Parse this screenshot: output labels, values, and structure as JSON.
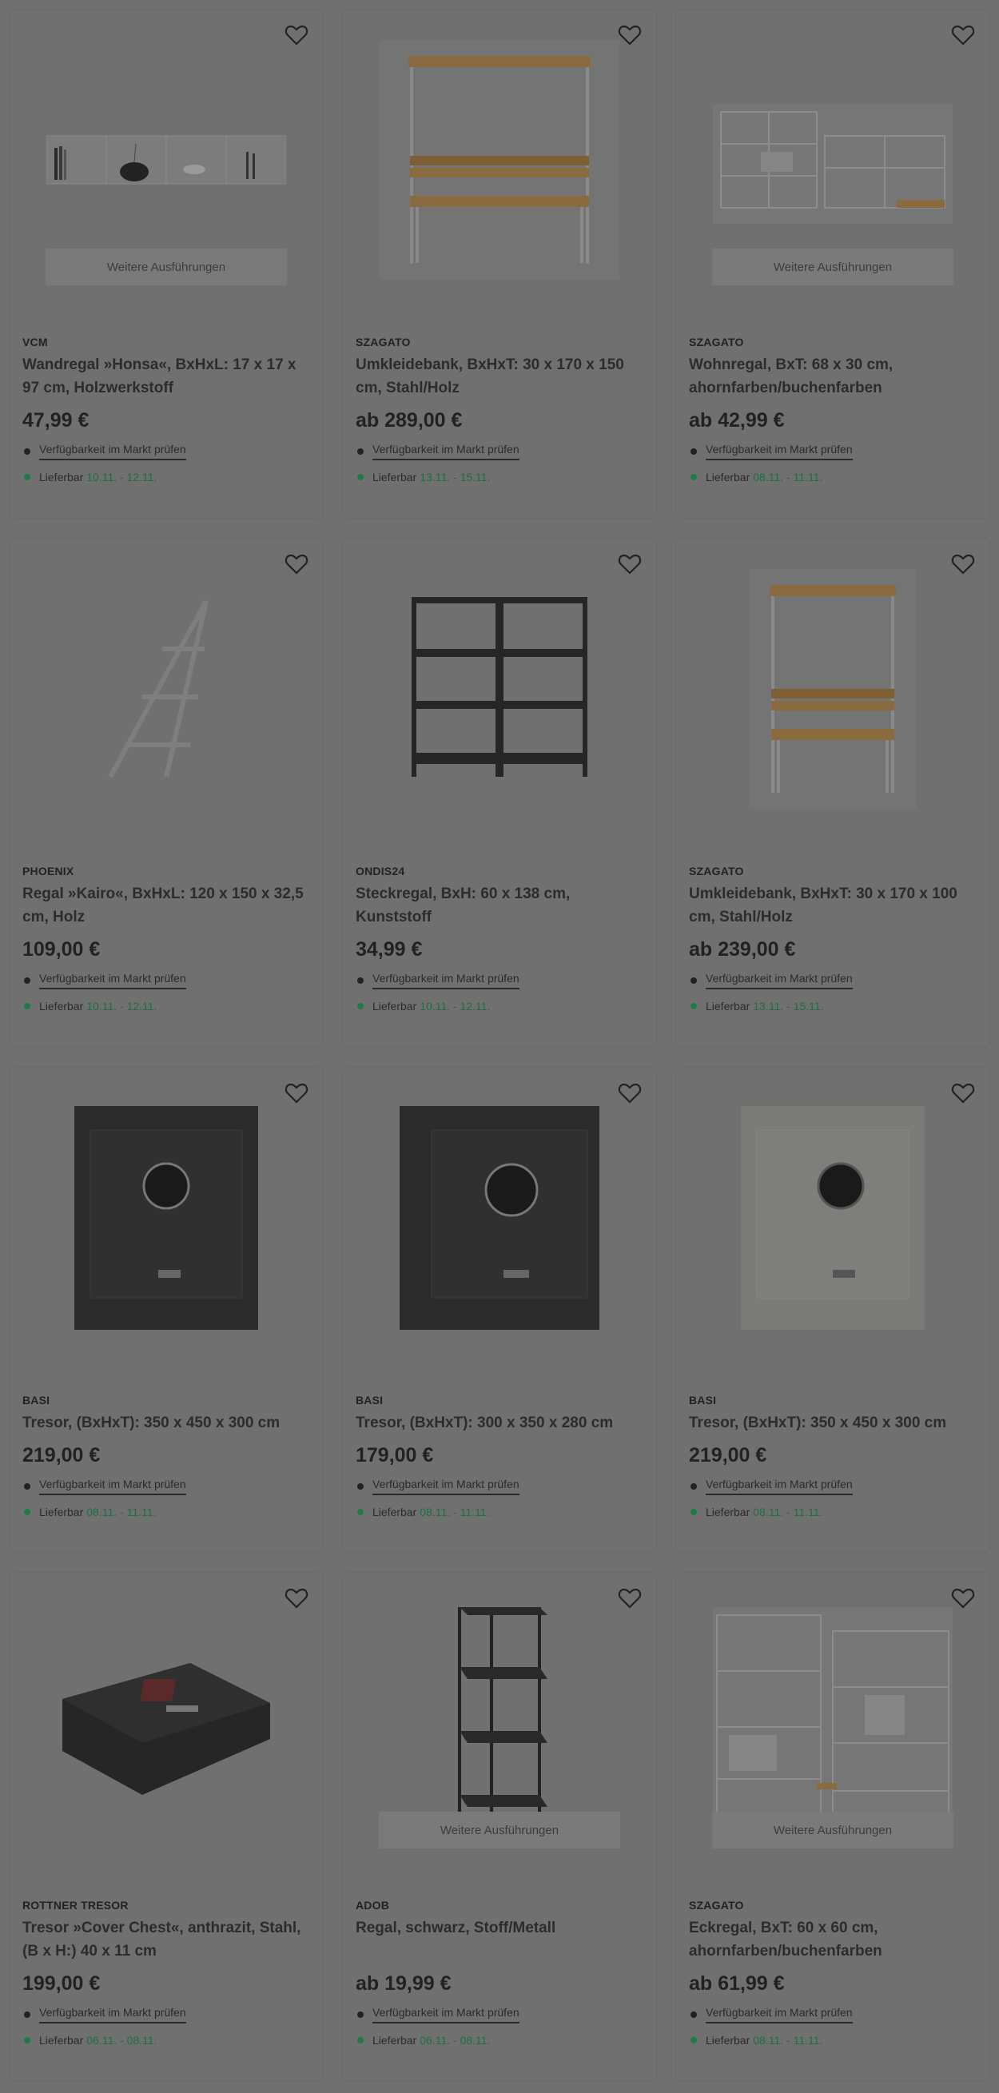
{
  "products": [
    {
      "brand": "VCM",
      "title": "Wandregal »Honsa«, BxHxL: 17 x 17 x 97 cm, Holzwerkstoff",
      "price": "47,99 €",
      "variants": "Weitere Ausführungen",
      "availability": "Verfügbarkeit im Markt prüfen",
      "delivery_label": "Lieferbar",
      "delivery_dates": "10.11. - 12.11.",
      "image": "wall-shelf-image"
    },
    {
      "brand": "SZAGATO",
      "title": "Umkleidebank, BxHxT: 30 x 170 x 150 cm, Stahl/Holz",
      "price": "ab 289,00 €",
      "variants": "",
      "availability": "Verfügbarkeit im Markt prüfen",
      "delivery_label": "Lieferbar",
      "delivery_dates": "13.11. - 15.11.",
      "image": "changing-bench-image"
    },
    {
      "brand": "SZAGATO",
      "title": "Wohnregal, BxT: 68 x 30 cm, ahornfarben/buchenfarben",
      "price": "ab 42,99 €",
      "variants": "Weitere Ausführungen",
      "availability": "Verfügbarkeit im Markt prüfen",
      "delivery_label": "Lieferbar",
      "delivery_dates": "08.11. - 11.11.",
      "image": "shelving-system-image"
    },
    {
      "brand": "PHOENIX",
      "title": "Regal »Kairo«, BxHxL: 120 x 150 x 32,5 cm, Holz",
      "price": "109,00 €",
      "variants": "",
      "availability": "Verfügbarkeit im Markt prüfen",
      "delivery_label": "Lieferbar",
      "delivery_dates": "10.11. - 12.11.",
      "image": "ladder-shelf-image"
    },
    {
      "brand": "ONDIS24",
      "title": "Steckregal, BxH: 60 x 138 cm, Kunststoff",
      "price": "34,99 €",
      "variants": "",
      "availability": "Verfügbarkeit im Markt prüfen",
      "delivery_label": "Lieferbar",
      "delivery_dates": "10.11. - 12.11.",
      "image": "plastic-rack-image"
    },
    {
      "brand": "SZAGATO",
      "title": "Umkleidebank, BxHxT: 30 x 170 x 100 cm, Stahl/Holz",
      "price": "ab 239,00 €",
      "variants": "",
      "availability": "Verfügbarkeit im Markt prüfen",
      "delivery_label": "Lieferbar",
      "delivery_dates": "13.11. - 15.11.",
      "image": "changing-bench-small-image"
    },
    {
      "brand": "BASI",
      "title": "Tresor, (BxHxT): 350 x 450 x 300 cm",
      "price": "219,00 €",
      "variants": "",
      "availability": "Verfügbarkeit im Markt prüfen",
      "delivery_label": "Lieferbar",
      "delivery_dates": "08.11. - 11.11.",
      "image": "safe-black-image"
    },
    {
      "brand": "BASI",
      "title": "Tresor, (BxHxT): 300 x 350 x 280 cm",
      "price": "179,00 €",
      "variants": "",
      "availability": "Verfügbarkeit im Markt prüfen",
      "delivery_label": "Lieferbar",
      "delivery_dates": "08.11. - 11.11.",
      "image": "safe-black-small-image"
    },
    {
      "brand": "BASI",
      "title": "Tresor, (BxHxT): 350 x 450 x 300 cm",
      "price": "219,00 €",
      "variants": "",
      "availability": "Verfügbarkeit im Markt prüfen",
      "delivery_label": "Lieferbar",
      "delivery_dates": "08.11. - 11.11.",
      "image": "safe-white-image"
    },
    {
      "brand": "ROTTNER TRESOR",
      "title": "Tresor »Cover Chest«, anthrazit, Stahl, (B x H:) 40 x 11 cm",
      "price": "199,00 €",
      "variants": "",
      "availability": "Verfügbarkeit im Markt prüfen",
      "delivery_label": "Lieferbar",
      "delivery_dates": "06.11. - 08.11.",
      "image": "cover-chest-image"
    },
    {
      "brand": "ADOB",
      "title": "Regal, schwarz, Stoff/Metall",
      "price": "ab 19,99 €",
      "variants": "Weitere Ausführungen",
      "availability": "Verfügbarkeit im Markt prüfen",
      "delivery_label": "Lieferbar",
      "delivery_dates": "06.11. - 08.11.",
      "image": "tower-shelf-image"
    },
    {
      "brand": "SZAGATO",
      "title": "Eckregal, BxT: 60 x 60 cm, ahornfarben/buchenfarben",
      "price": "ab 61,99 €",
      "variants": "Weitere Ausführungen",
      "availability": "Verfügbarkeit im Markt prüfen",
      "delivery_label": "Lieferbar",
      "delivery_dates": "08.11. - 11.11.",
      "image": "corner-shelf-image"
    }
  ],
  "colors": {
    "overlay": "#6f6f6f",
    "card": "#707070",
    "delivery_green": "#1d6e45"
  }
}
